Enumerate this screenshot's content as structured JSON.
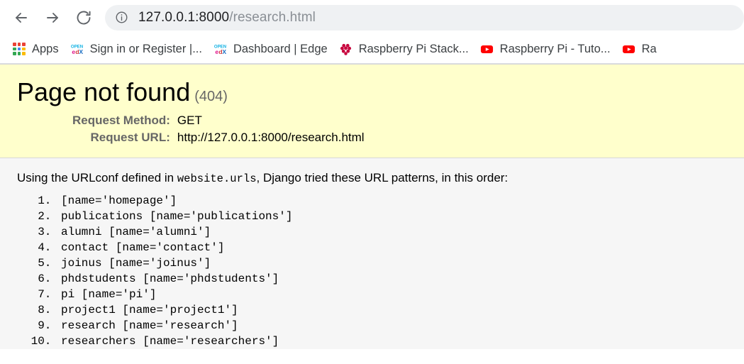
{
  "browser": {
    "back_icon": "back-arrow-icon",
    "forward_icon": "forward-arrow-icon",
    "reload_icon": "reload-icon",
    "site_info_icon": "site-info-icon",
    "url_host": "127.0.0.1:8000",
    "url_path": "/research.html",
    "url_full": "127.0.0.1:8000/research.html"
  },
  "bookmarks": [
    {
      "label": "Apps",
      "icon": "apps-grid-icon"
    },
    {
      "label": "Sign in or Register |...",
      "icon": "openedx-favicon"
    },
    {
      "label": "Dashboard | Edge",
      "icon": "openedx-favicon"
    },
    {
      "label": "Raspberry Pi Stack...",
      "icon": "raspberry-pi-favicon"
    },
    {
      "label": "Raspberry Pi - Tuto...",
      "icon": "youtube-favicon"
    },
    {
      "label": "Ra",
      "icon": "youtube-favicon"
    }
  ],
  "error_page": {
    "title": "Page not found",
    "status_code": "(404)",
    "request_method_label": "Request Method:",
    "request_method_value": "GET",
    "request_url_label": "Request URL:",
    "request_url_value": "http://127.0.0.1:8000/research.html",
    "urlconf_intro_prefix": "Using the URLconf defined in",
    "urlconf_module": "website.urls",
    "urlconf_intro_suffix": ", Django tried these URL patterns, in this order:",
    "url_patterns": [
      "[name='homepage']",
      "publications [name='publications']",
      "alumni [name='alumni']",
      "contact [name='contact']",
      "joinus [name='joinus']",
      "phdstudents [name='phdstudents']",
      "pi [name='pi']",
      "project1 [name='project1']",
      "research [name='research']",
      "researchers [name='researchers']"
    ]
  },
  "colors": {
    "summary_background": "#ffffcc",
    "page_background": "#f6f6f6",
    "label_gray": "#666666",
    "omnibox_background": "#eff1f3"
  }
}
